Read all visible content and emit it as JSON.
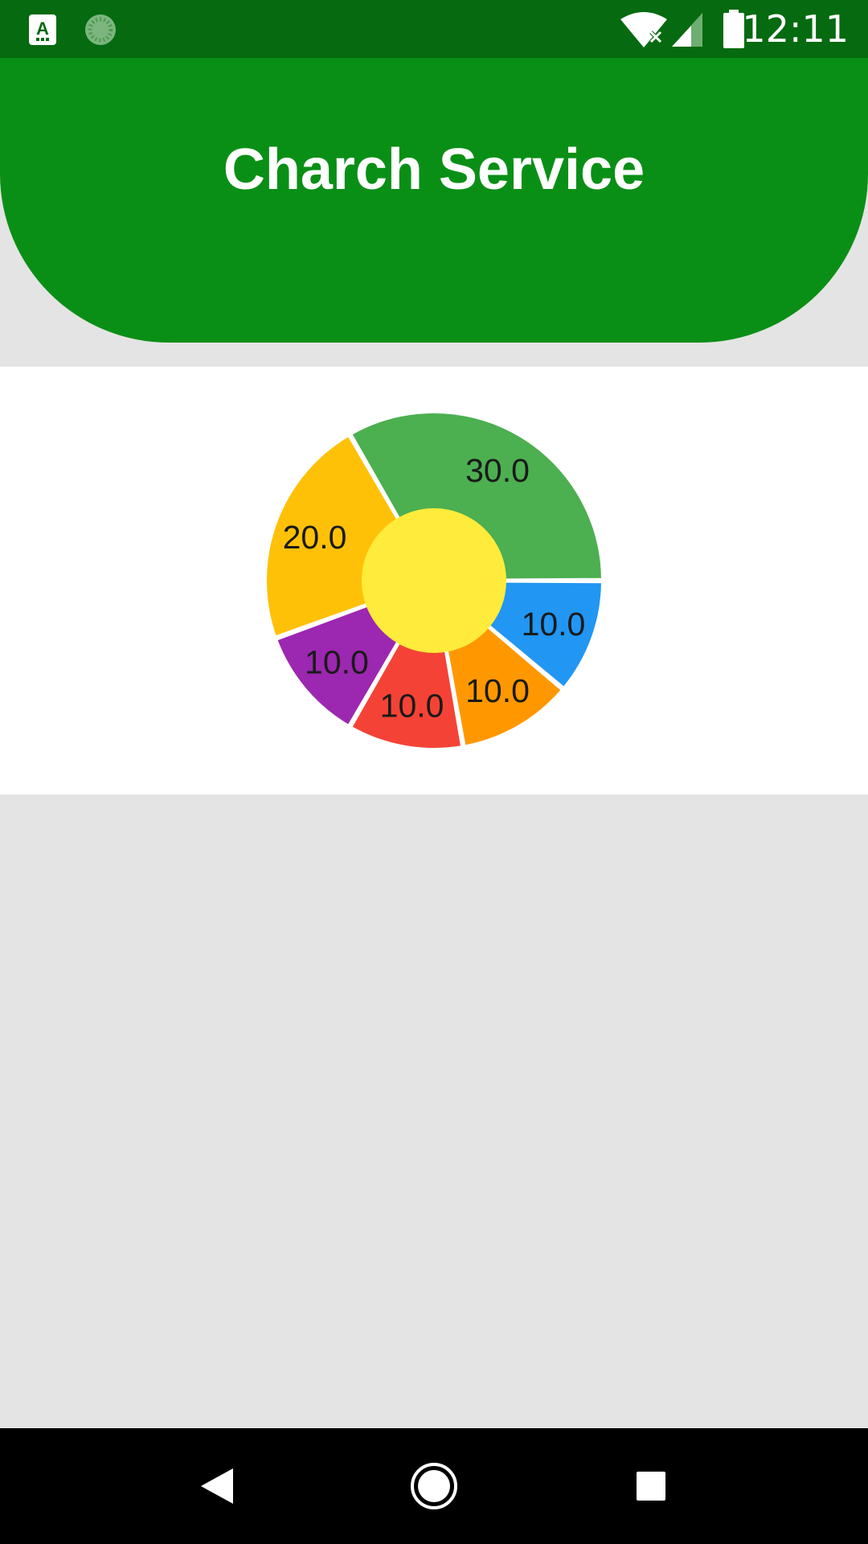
{
  "status_bar": {
    "time": "12:11",
    "icons": [
      "accessibility-font-icon",
      "loading-spinner-icon",
      "wifi-off-icon",
      "cell-signal-icon",
      "battery-icon"
    ]
  },
  "header": {
    "title": "Charch Service",
    "color": "#0a8f16"
  },
  "chart_data": {
    "type": "pie",
    "style": "donut",
    "center_color": "#ffeb3b",
    "slices": [
      {
        "value": 10.0,
        "label": "10.0",
        "color": "#2196f3"
      },
      {
        "value": 10.0,
        "label": "10.0",
        "color": "#ff9800"
      },
      {
        "value": 10.0,
        "label": "10.0",
        "color": "#f44336"
      },
      {
        "value": 10.0,
        "label": "10.0",
        "color": "#9c27b0"
      },
      {
        "value": 20.0,
        "label": "20.0",
        "color": "#ffc107"
      },
      {
        "value": 30.0,
        "label": "30.0",
        "color": "#4caf50"
      }
    ]
  },
  "nav_bar": {
    "buttons": [
      "back-icon",
      "home-icon",
      "recents-icon"
    ]
  }
}
